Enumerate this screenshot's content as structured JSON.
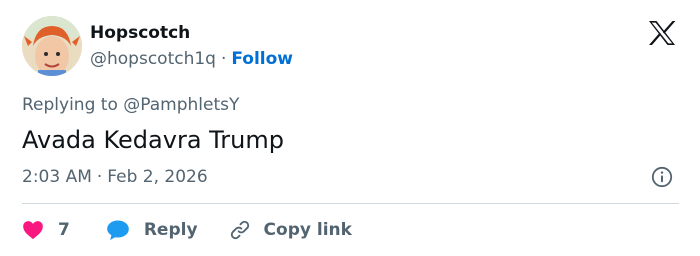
{
  "user": {
    "display_name": "Hopscotch",
    "handle": "@hopscotch1q",
    "separator": "·",
    "follow_label": "Follow"
  },
  "tweet": {
    "replying_prefix": "Replying to",
    "replying_to": "@PamphletsY",
    "text": "Avada Kedavra Trump",
    "time": "2:03 AM",
    "date": "Feb 2, 2026"
  },
  "actions": {
    "like_count": "7",
    "reply_label": "Reply",
    "copy_label": "Copy link"
  },
  "icons": {
    "brand": "x-logo-icon",
    "info": "info-icon",
    "like": "heart-icon",
    "reply": "speech-bubble-icon",
    "copy": "link-icon"
  },
  "colors": {
    "follow": "#006fd6",
    "heart": "#f91880",
    "reply_bubble": "#1d9bf0",
    "secondary_text": "#536471"
  }
}
